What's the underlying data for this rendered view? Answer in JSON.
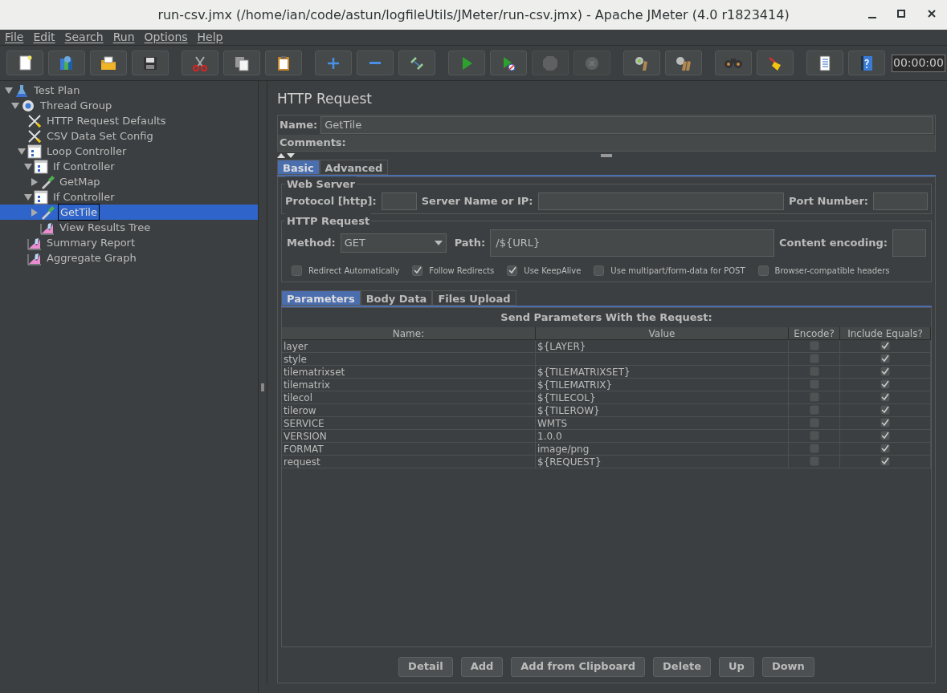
{
  "window": {
    "title": "run-csv.jmx (/home/ian/code/astun/logfileUtils/JMeter/run-csv.jmx) - Apache JMeter (4.0 r1823414)"
  },
  "menu": [
    "File",
    "Edit",
    "Search",
    "Run",
    "Options",
    "Help"
  ],
  "toolbar": {
    "groups": [
      [
        {
          "disabled": false
        },
        {
          "disabled": false
        },
        {
          "disabled": false
        },
        {
          "disabled": false
        }
      ],
      [
        {
          "disabled": false
        },
        {
          "disabled": false
        },
        {
          "disabled": false
        }
      ],
      [
        {
          "disabled": false
        },
        {
          "disabled": false
        },
        {
          "disabled": false
        }
      ],
      [
        {
          "disabled": false
        },
        {
          "disabled": false
        },
        {
          "disabled": true
        },
        {
          "disabled": true
        }
      ],
      [
        {
          "disabled": false
        },
        {
          "disabled": false
        }
      ],
      [
        {
          "disabled": false
        },
        {
          "disabled": false
        }
      ],
      [
        {
          "disabled": false
        },
        {
          "disabled": false
        }
      ]
    ],
    "timer": "00:00:00"
  },
  "tree": [
    {
      "label": "Test Plan",
      "kind": "plan",
      "expanded": true,
      "selected": false,
      "children": [
        {
          "label": "Thread Group",
          "kind": "threads",
          "expanded": true,
          "selected": false,
          "children": [
            {
              "label": "HTTP Request Defaults",
              "kind": "config",
              "selected": false
            },
            {
              "label": "CSV Data Set Config",
              "kind": "config",
              "selected": false
            },
            {
              "label": "Loop Controller",
              "kind": "controller",
              "expanded": true,
              "selected": false,
              "children": [
                {
                  "label": "If Controller",
                  "kind": "controller",
                  "expanded": true,
                  "selected": false,
                  "children": [
                    {
                      "label": "GetMap",
                      "kind": "sampler",
                      "expanded": false,
                      "selected": false
                    }
                  ]
                },
                {
                  "label": "If Controller",
                  "kind": "controller",
                  "expanded": true,
                  "selected": false,
                  "children": [
                    {
                      "label": "GetTile",
                      "kind": "sampler",
                      "expanded": false,
                      "selected": true
                    },
                    {
                      "label": "View Results Tree",
                      "kind": "listener",
                      "selected": false
                    }
                  ]
                }
              ]
            },
            {
              "label": "Summary Report",
              "kind": "listener",
              "selected": false
            },
            {
              "label": "Aggregate Graph",
              "kind": "listener",
              "selected": false
            }
          ]
        }
      ]
    }
  ],
  "editor": {
    "title": "HTTP Request",
    "name_label": "Name:",
    "name_value": "GetTile",
    "comments_label": "Comments:",
    "tabs": [
      {
        "label": "Basic",
        "selected": true
      },
      {
        "label": "Advanced",
        "selected": false
      }
    ],
    "web_server": {
      "title": "Web Server",
      "protocol_label": "Protocol [http]:",
      "server_label": "Server Name or IP:",
      "port_label": "Port Number:"
    },
    "http_request": {
      "title": "HTTP Request",
      "method_label": "Method:",
      "method_value": "GET",
      "path_label": "Path:",
      "path_value": "/${URL}",
      "encoding_label": "Content encoding:",
      "options": [
        {
          "label": "Redirect Automatically",
          "checked": false
        },
        {
          "label": "Follow Redirects",
          "checked": true
        },
        {
          "label": "Use KeepAlive",
          "checked": true
        },
        {
          "label": "Use multipart/form-data for POST",
          "checked": false
        },
        {
          "label": "Browser-compatible headers",
          "checked": false
        }
      ]
    },
    "sub_tabs": [
      {
        "label": "Parameters",
        "selected": true
      },
      {
        "label": "Body Data",
        "selected": false
      },
      {
        "label": "Files Upload",
        "selected": false
      }
    ],
    "table": {
      "title": "Send Parameters With the Request:",
      "columns": [
        "Name:",
        "Value",
        "Encode?",
        "Include Equals?"
      ],
      "rows": [
        {
          "name": "layer",
          "value": "${LAYER}",
          "encode": false,
          "include_equals": true
        },
        {
          "name": "style",
          "encode": false,
          "include_equals": true
        },
        {
          "name": "tilematrixset",
          "value": "${TILEMATRIXSET}",
          "encode": false,
          "include_equals": true
        },
        {
          "name": "tilematrix",
          "value": "${TILEMATRIX}",
          "encode": false,
          "include_equals": true
        },
        {
          "name": "tilecol",
          "value": "${TILECOL}",
          "encode": false,
          "include_equals": true
        },
        {
          "name": "tilerow",
          "value": "${TILEROW}",
          "encode": false,
          "include_equals": true
        },
        {
          "name": "SERVICE",
          "value": "WMTS",
          "encode": false,
          "include_equals": true
        },
        {
          "name": "VERSION",
          "value": "1.0.0",
          "encode": false,
          "include_equals": true
        },
        {
          "name": "FORMAT",
          "value": "image/png",
          "encode": false,
          "include_equals": true
        },
        {
          "name": "request",
          "value": "${REQUEST}",
          "encode": false,
          "include_equals": true
        }
      ]
    },
    "buttons": [
      "Detail",
      "Add",
      "Add from Clipboard",
      "Delete",
      "Up",
      "Down"
    ]
  }
}
